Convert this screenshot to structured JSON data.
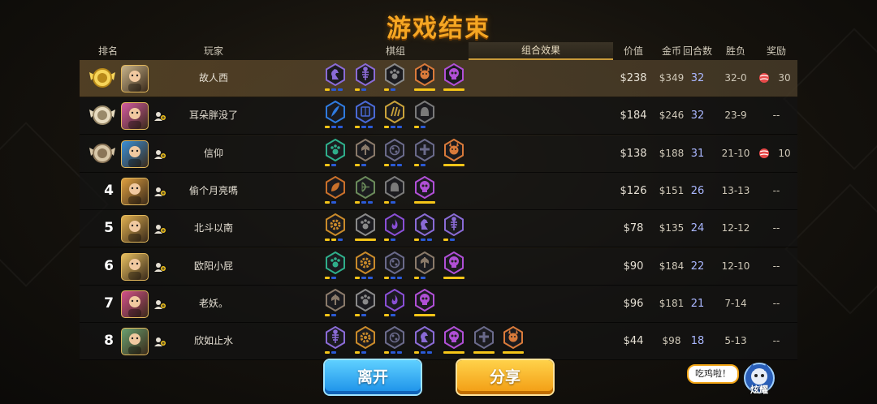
{
  "title": "游戏结束",
  "headers": {
    "rank": "排名",
    "player": "玩家",
    "lineup": "棋组",
    "combo": "组合效果",
    "value": "价值",
    "gold": "金币",
    "rounds": "回合数",
    "winloss": "胜负",
    "reward": "奖励"
  },
  "rows": [
    {
      "rank": "1",
      "medal": "gold-medal-icon",
      "name": "故人西",
      "value": "$238",
      "gold": "$349",
      "rounds": "32",
      "winloss": "32-0",
      "reward": "30",
      "has_reward_icon": true,
      "avatar": "#c9b48a",
      "friend": false,
      "traits": [
        {
          "icon": "knight-icon",
          "color": "#8a6bd6",
          "bars": [
            "#f5c518",
            "#2b5ad6",
            "#2b5ad6"
          ]
        },
        {
          "icon": "fishbone-icon",
          "color": "#8a6bd6",
          "bars": [
            "#f5c518",
            "#2b5ad6"
          ]
        },
        {
          "icon": "paw-icon",
          "color": "#8a8a8a",
          "bars": [
            "#f5c518",
            "#2b5ad6"
          ]
        },
        {
          "icon": "demon-icon",
          "color": "#d97a3a",
          "bars": [
            "#f5c518",
            "#f5c518"
          ]
        },
        {
          "icon": "skull-icon",
          "color": "#b04fd6",
          "bars": [
            "#f5c518",
            "#f5c518"
          ]
        }
      ]
    },
    {
      "rank": "2",
      "medal": "silver-medal-icon",
      "name": "耳朵胖没了",
      "value": "$184",
      "gold": "$246",
      "rounds": "32",
      "winloss": "23-9",
      "reward": "--",
      "has_reward_icon": false,
      "avatar": "#d45aa0",
      "friend": true,
      "traits": [
        {
          "icon": "feather-icon",
          "color": "#2f7be0",
          "bars": [
            "#f5c518",
            "#2b5ad6",
            "#2b5ad6"
          ]
        },
        {
          "icon": "book-icon",
          "color": "#4a6ad6",
          "bars": [
            "#f5c518",
            "#2b5ad6",
            "#2b5ad6"
          ]
        },
        {
          "icon": "claw-icon",
          "color": "#c9a23a",
          "bars": [
            "#f5c518",
            "#2b5ad6",
            "#2b5ad6"
          ]
        },
        {
          "icon": "helmet-icon",
          "color": "#7a7a7a",
          "bars": [
            "#f5c518",
            "#2b5ad6"
          ]
        }
      ]
    },
    {
      "rank": "3",
      "medal": "bronze-medal-icon",
      "name": "信仰",
      "value": "$138",
      "gold": "$188",
      "rounds": "31",
      "winloss": "21-10",
      "reward": "10",
      "has_reward_icon": true,
      "avatar": "#3a8fd6",
      "friend": true,
      "traits": [
        {
          "icon": "paw-icon",
          "color": "#2fae8a",
          "bars": [
            "#f5c518",
            "#2b5ad6"
          ]
        },
        {
          "icon": "axe-icon",
          "color": "#8a7a6a",
          "bars": [
            "#f5c518",
            "#2b5ad6"
          ]
        },
        {
          "icon": "orb-icon",
          "color": "#6a6a8a",
          "bars": [
            "#f5c518",
            "#2b5ad6",
            "#2b5ad6"
          ]
        },
        {
          "icon": "cross-icon",
          "color": "#6a6a8a",
          "bars": [
            "#f5c518",
            "#2b5ad6"
          ]
        },
        {
          "icon": "demon-icon",
          "color": "#d97a3a",
          "bars": [
            "#f5c518",
            "#f5c518"
          ]
        }
      ]
    },
    {
      "rank": "4",
      "medal": "",
      "name": "偷个月亮嗎",
      "value": "$126",
      "gold": "$151",
      "rounds": "26",
      "winloss": "13-13",
      "reward": "--",
      "has_reward_icon": false,
      "avatar": "#e0a040",
      "friend": true,
      "traits": [
        {
          "icon": "leaf-icon",
          "color": "#c9702a",
          "bars": [
            "#f5c518",
            "#2b5ad6"
          ]
        },
        {
          "icon": "bow-icon",
          "color": "#6a8a5a",
          "bars": [
            "#f5c518",
            "#2b5ad6",
            "#2b5ad6"
          ]
        },
        {
          "icon": "helmet-icon",
          "color": "#7a7a7a",
          "bars": [
            "#f5c518",
            "#2b5ad6"
          ]
        },
        {
          "icon": "skull-icon",
          "color": "#b04fd6",
          "bars": [
            "#f5c518",
            "#f5c518"
          ]
        }
      ]
    },
    {
      "rank": "5",
      "medal": "",
      "name": "北斗以南",
      "value": "$78",
      "gold": "$135",
      "rounds": "24",
      "winloss": "12-12",
      "reward": "--",
      "has_reward_icon": false,
      "avatar": "#e0b050",
      "friend": true,
      "traits": [
        {
          "icon": "gear-icon",
          "color": "#c98a2a",
          "bars": [
            "#f5c518",
            "#f5c518",
            "#2b5ad6"
          ]
        },
        {
          "icon": "paw-icon",
          "color": "#8a8a8a",
          "bars": [
            "#f5c518",
            "#f5c518"
          ]
        },
        {
          "icon": "flame-icon",
          "color": "#8a4fd6",
          "bars": [
            "#f5c518",
            "#2b5ad6"
          ]
        },
        {
          "icon": "knight-icon",
          "color": "#8a6bd6",
          "bars": [
            "#f5c518",
            "#2b5ad6",
            "#2b5ad6"
          ]
        },
        {
          "icon": "fishbone-icon",
          "color": "#8a6bd6",
          "bars": [
            "#f5c518",
            "#2b5ad6"
          ]
        }
      ]
    },
    {
      "rank": "6",
      "medal": "",
      "name": "欧阳小屁",
      "value": "$90",
      "gold": "$184",
      "rounds": "22",
      "winloss": "12-10",
      "reward": "--",
      "has_reward_icon": false,
      "avatar": "#e8c060",
      "friend": true,
      "traits": [
        {
          "icon": "paw-icon",
          "color": "#2fae8a",
          "bars": [
            "#f5c518",
            "#2b5ad6"
          ]
        },
        {
          "icon": "gear-icon",
          "color": "#c98a2a",
          "bars": [
            "#f5c518",
            "#2b5ad6",
            "#2b5ad6"
          ]
        },
        {
          "icon": "orb-icon",
          "color": "#6a6a8a",
          "bars": [
            "#f5c518",
            "#2b5ad6",
            "#2b5ad6"
          ]
        },
        {
          "icon": "axe-icon",
          "color": "#8a7a6a",
          "bars": [
            "#f5c518",
            "#2b5ad6"
          ]
        },
        {
          "icon": "skull-icon",
          "color": "#b04fd6",
          "bars": [
            "#f5c518",
            "#f5c518"
          ]
        }
      ]
    },
    {
      "rank": "7",
      "medal": "",
      "name": "老妖。",
      "value": "$96",
      "gold": "$181",
      "rounds": "21",
      "winloss": "7-14",
      "reward": "--",
      "has_reward_icon": false,
      "avatar": "#d4508a",
      "friend": true,
      "traits": [
        {
          "icon": "axe-icon",
          "color": "#8a7a6a",
          "bars": [
            "#f5c518",
            "#2b5ad6"
          ]
        },
        {
          "icon": "paw-icon",
          "color": "#8a8a8a",
          "bars": [
            "#f5c518",
            "#2b5ad6"
          ]
        },
        {
          "icon": "flame-icon",
          "color": "#8a4fd6",
          "bars": [
            "#f5c518",
            "#2b5ad6"
          ]
        },
        {
          "icon": "skull-icon",
          "color": "#b04fd6",
          "bars": [
            "#f5c518",
            "#f5c518"
          ]
        }
      ]
    },
    {
      "rank": "8",
      "medal": "",
      "name": "欣如止水",
      "value": "$44",
      "gold": "$98",
      "rounds": "18",
      "winloss": "5-13",
      "reward": "--",
      "has_reward_icon": false,
      "avatar": "#6aa070",
      "friend": true,
      "traits": [
        {
          "icon": "fishbone-icon",
          "color": "#8a6bd6",
          "bars": [
            "#f5c518",
            "#2b5ad6"
          ]
        },
        {
          "icon": "gear-icon",
          "color": "#c98a2a",
          "bars": [
            "#f5c518",
            "#2b5ad6"
          ]
        },
        {
          "icon": "orb-icon",
          "color": "#6a6a8a",
          "bars": [
            "#f5c518",
            "#2b5ad6",
            "#2b5ad6"
          ]
        },
        {
          "icon": "knight-icon",
          "color": "#8a6bd6",
          "bars": [
            "#f5c518",
            "#2b5ad6",
            "#2b5ad6"
          ]
        },
        {
          "icon": "skull-icon",
          "color": "#b04fd6",
          "bars": [
            "#f5c518",
            "#f5c518"
          ]
        },
        {
          "icon": "cross-icon",
          "color": "#6a6a8a",
          "bars": [
            "#f5c518",
            "#f5c518"
          ]
        },
        {
          "icon": "demon-icon",
          "color": "#d97a3a",
          "bars": [
            "#f5c518",
            "#f5c518"
          ]
        }
      ]
    }
  ],
  "buttons": {
    "leave": "离开",
    "share": "分享"
  },
  "brag": {
    "bubble": "吃鸡啦！",
    "label": "炫耀"
  }
}
